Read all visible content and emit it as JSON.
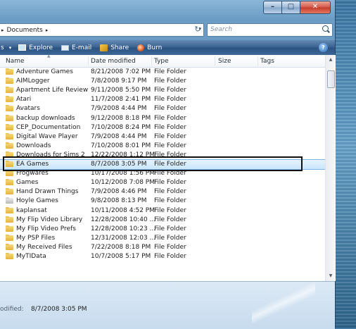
{
  "window": {
    "caption_buttons": {
      "minimize": "–",
      "maximize": "□",
      "close": "✕"
    }
  },
  "address": {
    "path_arrow": "▸",
    "location": "Documents",
    "location_arrow": "▸",
    "dropdown": "▾",
    "refresh": "↻",
    "search_placeholder": "Search"
  },
  "toolbar": {
    "organize_tail": "s",
    "views_arrow": "▾",
    "explore": "Explore",
    "email": "E-mail",
    "share": "Share",
    "burn": "Burn",
    "help": "?"
  },
  "columns": [
    "Name",
    "Date modified",
    "Type",
    "Size",
    "Tags"
  ],
  "files": [
    {
      "name": "Adventure Games",
      "date": "8/21/2008 7:02 PM",
      "type": "File Folder"
    },
    {
      "name": "AIMLogger",
      "date": "7/8/2008 9:17 PM",
      "type": "File Folder"
    },
    {
      "name": "Apartment Life Review",
      "date": "9/11/2008 5:50 PM",
      "type": "File Folder"
    },
    {
      "name": "Atari",
      "date": "11/7/2008 2:41 PM",
      "type": "File Folder"
    },
    {
      "name": "Avatars",
      "date": "7/9/2008 4:44 PM",
      "type": "File Folder"
    },
    {
      "name": "backup downloads",
      "date": "9/12/2008 8:18 PM",
      "type": "File Folder"
    },
    {
      "name": "CEP_Documentation",
      "date": "7/10/2008 8:24 PM",
      "type": "File Folder"
    },
    {
      "name": "Digital Wave Player",
      "date": "7/9/2008 4:44 PM",
      "type": "File Folder"
    },
    {
      "name": "Downloads",
      "date": "7/10/2008 8:01 PM",
      "type": "File Folder"
    },
    {
      "name": "Downloads for Sims 2",
      "date": "12/22/2008 1:12 PM",
      "type": "File Folder"
    },
    {
      "name": "EA Games",
      "date": "8/7/2008 3:05 PM",
      "type": "File Folder",
      "selected": true
    },
    {
      "name": "Frogwares",
      "date": "10/17/2008 1:56 PM",
      "type": "File Folder"
    },
    {
      "name": "Games",
      "date": "10/12/2008 7:08 PM",
      "type": "File Folder"
    },
    {
      "name": "Hand Drawn Things",
      "date": "7/9/2008 4:46 PM",
      "type": "File Folder"
    },
    {
      "name": "Hoyle Games",
      "date": "9/8/2008 8:13 PM",
      "type": "File Folder",
      "special": true
    },
    {
      "name": "kaplansat",
      "date": "10/11/2008 4:52 PM",
      "type": "File Folder"
    },
    {
      "name": "My Flip Video Library",
      "date": "12/28/2008 10:40 ...",
      "type": "File Folder"
    },
    {
      "name": "My Flip Video Prefs",
      "date": "12/28/2008 10:23 ...",
      "type": "File Folder"
    },
    {
      "name": "My PSP Files",
      "date": "12/31/2008 12:03 ...",
      "type": "File Folder"
    },
    {
      "name": "My Received Files",
      "date": "7/22/2008 8:18 PM",
      "type": "File Folder"
    },
    {
      "name": "MyTIData",
      "date": "10/7/2008 5:17 PM",
      "type": "File Folder"
    }
  ],
  "details": {
    "label": "odified:",
    "value": "8/7/2008 3:05 PM"
  }
}
